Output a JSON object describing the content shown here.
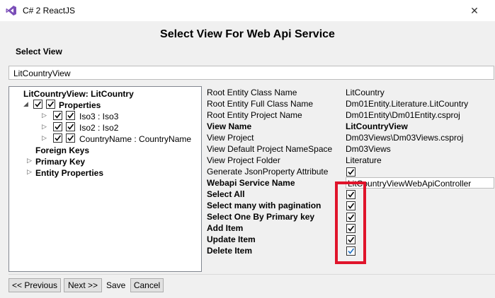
{
  "window": {
    "title": "C# 2 ReactJS",
    "close_glyph": "✕"
  },
  "heading": "Select View For Web Api Service",
  "select_view_label": "Select View",
  "view_combo_value": "LitCountryView",
  "tree": {
    "root": "LitCountryView: LitCountry",
    "properties": "Properties",
    "props": [
      "Iso3 : Iso3",
      "Iso2 : Iso2",
      "CountryName : CountryName"
    ],
    "foreign_keys": "Foreign Keys",
    "primary_key": "Primary Key",
    "entity_properties": "Entity Properties"
  },
  "properties": {
    "root_entity_class_name": {
      "label": "Root Entity Class Name",
      "value": "LitCountry"
    },
    "root_entity_full_class_name": {
      "label": "Root Entity Full Class Name",
      "value": "Dm01Entity.Literature.LitCountry"
    },
    "root_entity_project_name": {
      "label": "Root Entity Project Name",
      "value": "Dm01Entity\\Dm01Entity.csproj"
    },
    "view_name": {
      "label": "View Name",
      "value": "LitCountryView"
    },
    "view_project": {
      "label": "View Project",
      "value": "Dm03Views\\Dm03Views.csproj"
    },
    "view_default_namespace": {
      "label": "View Default Project NameSpace",
      "value": "Dm03Views"
    },
    "view_project_folder": {
      "label": "View Project Folder",
      "value": "Literature"
    },
    "generate_json_attribute": {
      "label": "Generate JsonProperty Attribute",
      "checked": true
    },
    "webapi_service_name": {
      "label": "Webapi Service Name",
      "value": "LitCountryViewWebApiController"
    },
    "select_all": {
      "label": "Select All",
      "checked": true
    },
    "select_many": {
      "label": "Select many with pagination",
      "checked": true
    },
    "select_one": {
      "label": "Select One By Primary key",
      "checked": true
    },
    "add_item": {
      "label": "Add Item",
      "checked": true
    },
    "update_item": {
      "label": "Update Item",
      "checked": true
    },
    "delete_item": {
      "label": "Delete Item",
      "checked": true
    }
  },
  "buttons": {
    "previous": "<< Previous",
    "next": "Next >>",
    "save": "Save",
    "cancel": "Cancel"
  },
  "colors": {
    "highlight": "#e0142b",
    "check": "#000000"
  }
}
